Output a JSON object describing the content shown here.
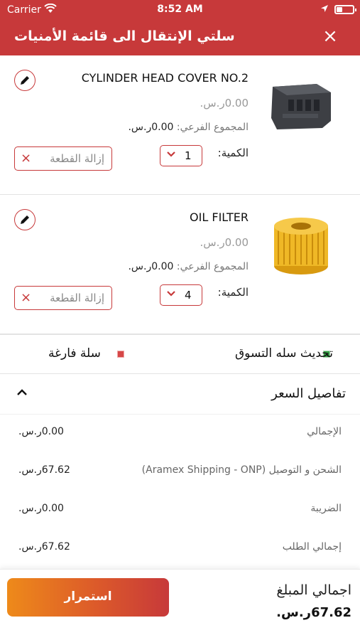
{
  "status_bar": {
    "carrier": "Carrier",
    "time": "8:52 AM"
  },
  "header": {
    "title": "سلتي الإنتقال الى قائمة الأمنيات",
    "close_icon": "×"
  },
  "items": [
    {
      "name": "CYLINDER HEAD COVER NO.2",
      "price": "0.00ر.س.",
      "subtotal_label": "المجموع الفرعي:",
      "subtotal_value": "0.00ر.س.",
      "qty_label": "الكمية:",
      "qty": "1",
      "remove_label": "إزالة القطعة",
      "remove_icon": "×"
    },
    {
      "name": "OIL FILTER",
      "price": "0.00ر.س.",
      "subtotal_label": "المجموع الفرعي:",
      "subtotal_value": "0.00ر.س.",
      "qty_label": "الكمية:",
      "qty": "4",
      "remove_label": "إزالة القطعة",
      "remove_icon": "×"
    }
  ],
  "actions": {
    "update_cart": "تحديث سله التسوق",
    "empty_cart": "سلة فارغة"
  },
  "price_details": {
    "title": "تفاصيل السعر",
    "rows": [
      {
        "label": "الإجمالي",
        "value": "0.00ر.س."
      },
      {
        "label": "الشحن و التوصيل (Aramex Shipping - ONP)",
        "value": "67.62ر.س."
      },
      {
        "label": "الضريبة",
        "value": "0.00ر.س."
      },
      {
        "label": "إجمالي الطلب",
        "value": "67.62ر.س."
      }
    ]
  },
  "footer": {
    "total_label": "اجمالي المبلغ",
    "total_value": "67.62ر.س.",
    "continue_label": "استمرار"
  },
  "colors": {
    "brand": "#c7393a",
    "button_start": "#ee8a1a",
    "button_end": "#c7393a"
  }
}
